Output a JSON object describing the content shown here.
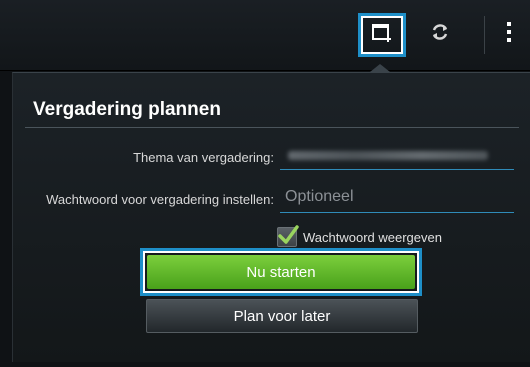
{
  "actionbar": {
    "icons": [
      "new-meeting-icon",
      "sync-icon",
      "more-menu-icon"
    ]
  },
  "dialog": {
    "title": "Vergadering plannen",
    "topic_label": "Thema van vergadering:",
    "password_label": "Wachtwoord voor vergadering instellen:",
    "password_placeholder": "Optioneel",
    "show_password_label": "Wachtwoord weergeven",
    "start_button": "Nu starten",
    "later_button": "Plan voor later"
  },
  "colors": {
    "accent_blue": "#1e8fc8",
    "start_green": "#5cb82a",
    "background": "#0f1215"
  }
}
